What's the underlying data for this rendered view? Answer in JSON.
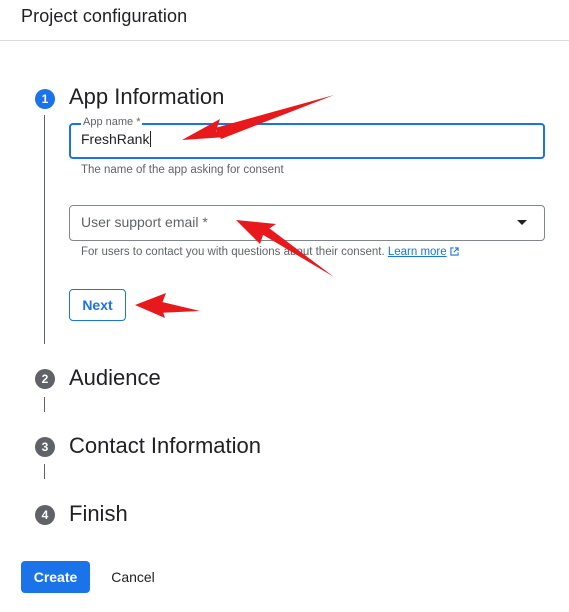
{
  "header": {
    "title": "Project configuration"
  },
  "steps": [
    {
      "number": "1",
      "title": "App Information",
      "state": "active"
    },
    {
      "number": "2",
      "title": "Audience",
      "state": "inactive"
    },
    {
      "number": "3",
      "title": "Contact Information",
      "state": "inactive"
    },
    {
      "number": "4",
      "title": "Finish",
      "state": "inactive"
    }
  ],
  "app_info": {
    "app_name": {
      "label": "App name *",
      "value": "FreshRank",
      "hint": "The name of the app asking for consent"
    },
    "support_email": {
      "placeholder": "User support email *",
      "hint": "For users to contact you with questions about their consent.",
      "link_text": "Learn more",
      "link_icon": "open-in-new-icon"
    },
    "next_label": "Next"
  },
  "footer": {
    "create_label": "Create",
    "cancel_label": "Cancel"
  },
  "colors": {
    "accent": "#1a73e8",
    "annotation_arrow": "#e8191c",
    "inactive_step": "#5f6368"
  }
}
